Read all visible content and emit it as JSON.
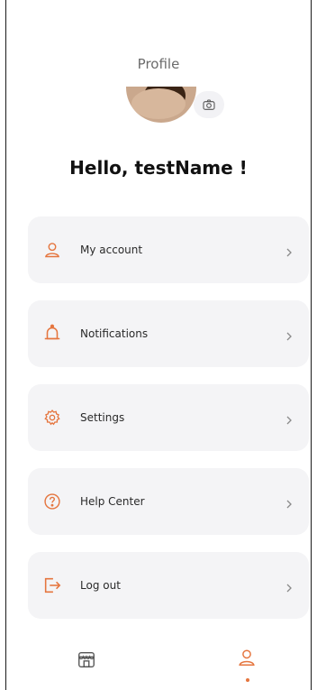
{
  "header": {
    "title": "Profile"
  },
  "greeting": "Hello, testName !",
  "menu": [
    {
      "label": "My account",
      "icon": "user-icon"
    },
    {
      "label": "Notifications",
      "icon": "bell-icon"
    },
    {
      "label": "Settings",
      "icon": "gear-icon"
    },
    {
      "label": "Help Center",
      "icon": "help-icon"
    },
    {
      "label": "Log out",
      "icon": "logout-icon"
    }
  ],
  "tabbar": {
    "items": [
      {
        "icon": "store-icon",
        "active": false
      },
      {
        "icon": "user-icon",
        "active": true
      }
    ]
  },
  "colors": {
    "accent": "#e5753e",
    "card_bg": "#f4f4f6"
  }
}
